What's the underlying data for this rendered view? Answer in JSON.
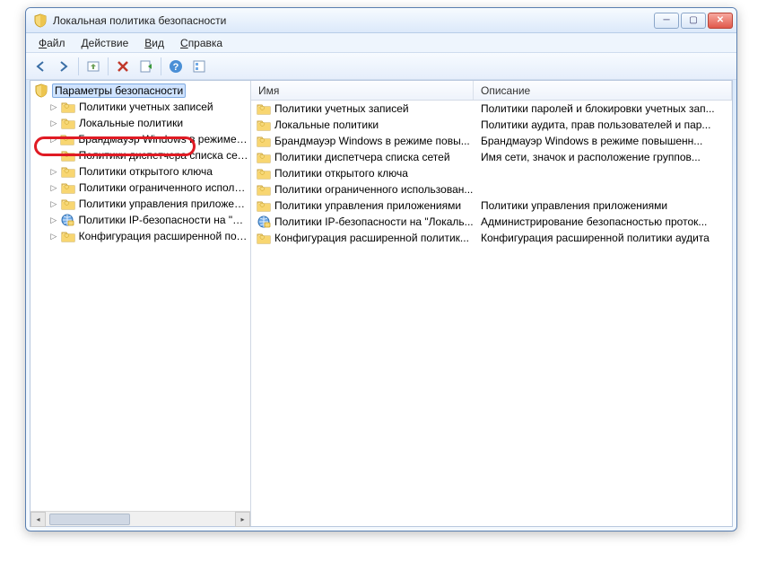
{
  "window": {
    "title": "Локальная политика безопасности"
  },
  "menu": {
    "file": "Файл",
    "action": "Действие",
    "view": "Вид",
    "help": "Справка"
  },
  "tree": {
    "root": "Параметры безопасности",
    "items": [
      "Политики учетных записей",
      "Локальные политики",
      "Брандмауэр Windows в режиме пов",
      "Политики диспетчера списка сетей",
      "Политики открытого ключа",
      "Политики ограниченного использо",
      "Политики управления приложения",
      "Политики IP-безопасности на \"Лока",
      "Конфигурация расширенной полит"
    ]
  },
  "columns": {
    "name": "Имя",
    "desc": "Описание"
  },
  "rows": [
    {
      "name": "Политики учетных записей",
      "desc": "Политики паролей и блокировки учетных зап...",
      "icon": "folder"
    },
    {
      "name": "Локальные политики",
      "desc": "Политики аудита, прав пользователей и пар...",
      "icon": "folder"
    },
    {
      "name": "Брандмауэр Windows в режиме повы...",
      "desc": "Брандмауэр Windows в режиме повышенн...",
      "icon": "folder"
    },
    {
      "name": "Политики диспетчера списка сетей",
      "desc": "Имя сети, значок и расположение группов...",
      "icon": "folder"
    },
    {
      "name": "Политики открытого ключа",
      "desc": "",
      "icon": "folder"
    },
    {
      "name": "Политики ограниченного использован...",
      "desc": "",
      "icon": "folder"
    },
    {
      "name": "Политики управления приложениями",
      "desc": "Политики управления приложениями",
      "icon": "folder"
    },
    {
      "name": "Политики IP-безопасности на \"Локаль...",
      "desc": "Администрирование безопасностью проток...",
      "icon": "ipsec"
    },
    {
      "name": "Конфигурация расширенной политик...",
      "desc": "Конфигурация расширенной политики аудита",
      "icon": "folder"
    }
  ]
}
